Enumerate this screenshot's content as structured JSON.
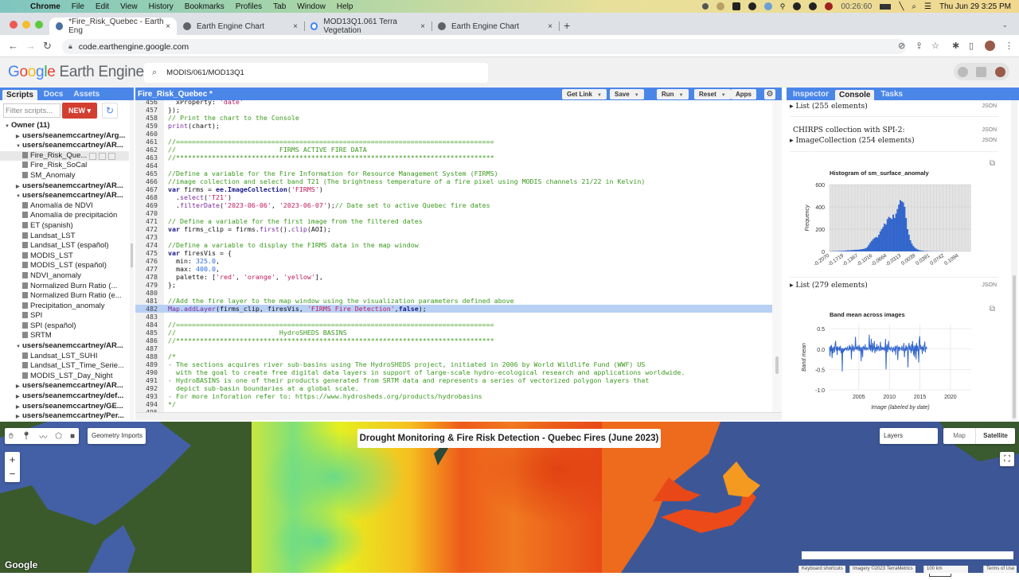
{
  "menubar": {
    "app": "Chrome",
    "items": [
      "File",
      "Edit",
      "View",
      "History",
      "Bookmarks",
      "Profiles",
      "Tab",
      "Window",
      "Help"
    ],
    "timer": "00:26:60",
    "datetime": "Thu Jun 29  3:25 PM"
  },
  "browser": {
    "tabs": [
      {
        "title": "*Fire_Risk_Quebec - Earth Eng",
        "active": true
      },
      {
        "title": "Earth Engine Chart",
        "active": false
      },
      {
        "title": "MOD13Q1.061 Terra Vegetation",
        "active": false
      },
      {
        "title": "Earth Engine Chart",
        "active": false
      }
    ],
    "close": "×",
    "new_tab": "+",
    "url": "code.earthengine.google.com"
  },
  "header": {
    "logo_parts": [
      "G",
      "o",
      "o",
      "g",
      "l",
      "e"
    ],
    "logo_suffix": " Earth Engine",
    "search_value": "MODIS/061/MOD13Q1"
  },
  "left_panel": {
    "tabs": [
      "Scripts",
      "Docs",
      "Assets"
    ],
    "active_tab": "Scripts",
    "filter_placeholder": "Filter scripts...",
    "new_label": "NEW ▾",
    "refresh_icon": "↻",
    "tree": [
      {
        "type": "own",
        "label": "Owner (11)",
        "open": true
      },
      {
        "type": "folder",
        "label": "users/seanemccartney/Arg...",
        "open": false
      },
      {
        "type": "folder",
        "label": "users/seanemccartney/AR...",
        "open": true
      },
      {
        "type": "file",
        "label": "Fire_Risk_Que...",
        "selected": true
      },
      {
        "type": "file",
        "label": "Fire_Risk_SoCal"
      },
      {
        "type": "file",
        "label": "SM_Anomaly"
      },
      {
        "type": "folder",
        "label": "users/seanemccartney/AR...",
        "open": false
      },
      {
        "type": "folder",
        "label": "users/seanemccartney/AR...",
        "open": true
      },
      {
        "type": "file",
        "label": "Anomalía de NDVI"
      },
      {
        "type": "file",
        "label": "Anomalía de precipitación"
      },
      {
        "type": "file",
        "label": "ET (spanish)"
      },
      {
        "type": "file",
        "label": "Landsat_LST"
      },
      {
        "type": "file",
        "label": "Landsat_LST (español)"
      },
      {
        "type": "file",
        "label": "MODIS_LST"
      },
      {
        "type": "file",
        "label": "MODIS_LST (español)"
      },
      {
        "type": "file",
        "label": "NDVI_anomaly"
      },
      {
        "type": "file",
        "label": "Normalized Burn Ratio (..."
      },
      {
        "type": "file",
        "label": "Normalized Burn Ratio (e..."
      },
      {
        "type": "file",
        "label": "Precipitation_anomaly"
      },
      {
        "type": "file",
        "label": "SPI"
      },
      {
        "type": "file",
        "label": "SPI (español)"
      },
      {
        "type": "file",
        "label": "SRTM"
      },
      {
        "type": "folder",
        "label": "users/seanemccartney/AR...",
        "open": true
      },
      {
        "type": "file",
        "label": "Landsat_LST_SUHI"
      },
      {
        "type": "file",
        "label": "Landsat_LST_Time_Serie..."
      },
      {
        "type": "file",
        "label": "MODIS_LST_Day_Night"
      },
      {
        "type": "folder",
        "label": "users/seanemccartney/AR...",
        "open": false
      },
      {
        "type": "folder",
        "label": "users/seanemccartney/def...",
        "open": false
      },
      {
        "type": "folder",
        "label": "users/seanemccartney/GE...",
        "open": false
      },
      {
        "type": "folder",
        "label": "users/seanemccartney/Per...",
        "open": false
      }
    ]
  },
  "editor": {
    "title": "Fire_Risk_Quebec *",
    "buttons": [
      "Get Link",
      "Save",
      "Run",
      "Reset",
      "Apps"
    ],
    "highlighted_line": 482,
    "lines": [
      {
        "n": "456",
        "t": [
          [
            "p",
            "  xProperty: "
          ],
          [
            "s",
            "'date'"
          ]
        ]
      },
      {
        "n": "457",
        "t": [
          [
            "p",
            "});"
          ]
        ]
      },
      {
        "n": "458",
        "t": [
          [
            "c",
            "// Print the chart to the Console"
          ]
        ]
      },
      {
        "n": "459",
        "t": [
          [
            "f",
            "print"
          ],
          [
            "p",
            "(chart);"
          ]
        ]
      },
      {
        "n": "460",
        "t": []
      },
      {
        "n": "461",
        "t": [
          [
            "c",
            "//================================================================================"
          ]
        ]
      },
      {
        "n": "462",
        "t": [
          [
            "c",
            "//                          FIRMS ACTIVE FIRE DATA"
          ]
        ]
      },
      {
        "n": "463",
        "t": [
          [
            "c",
            "//********************************************************************************"
          ]
        ]
      },
      {
        "n": "464",
        "t": []
      },
      {
        "n": "465",
        "t": [
          [
            "c",
            "//Define a variable for the Fire Information for Resource Management System (FIRMS)"
          ]
        ]
      },
      {
        "n": "466",
        "t": [
          [
            "c",
            "//image collection and select band T21 (The brightness temperature of a fire pixel using MODIS channels 21/22 in Kelvin)"
          ]
        ]
      },
      {
        "n": "467",
        "t": [
          [
            "k",
            "var"
          ],
          [
            "p",
            " firms = "
          ],
          [
            "k",
            "ee.ImageCollection"
          ],
          [
            "p",
            "("
          ],
          [
            "s",
            "'FIRMS'"
          ],
          [
            "p",
            ")"
          ]
        ]
      },
      {
        "n": "468",
        "t": [
          [
            "p",
            "  ."
          ],
          [
            "f",
            "select"
          ],
          [
            "p",
            "("
          ],
          [
            "s",
            "'T21'"
          ],
          [
            "p",
            ")"
          ]
        ]
      },
      {
        "n": "469",
        "t": [
          [
            "p",
            "  ."
          ],
          [
            "f",
            "filterDate"
          ],
          [
            "p",
            "("
          ],
          [
            "s",
            "'2023-06-06'"
          ],
          [
            "p",
            ", "
          ],
          [
            "s",
            "'2023-06-07'"
          ],
          [
            "p",
            ");"
          ],
          [
            "c",
            "// Date set to active Quebec fire dates"
          ]
        ]
      },
      {
        "n": "470",
        "t": []
      },
      {
        "n": "471",
        "t": [
          [
            "c",
            "// Define a variable for the first image from the filtered dates"
          ]
        ]
      },
      {
        "n": "472",
        "t": [
          [
            "k",
            "var"
          ],
          [
            "p",
            " firms_clip = firms."
          ],
          [
            "f",
            "first"
          ],
          [
            "p",
            "()."
          ],
          [
            "f",
            "clip"
          ],
          [
            "p",
            "(AOI);"
          ]
        ]
      },
      {
        "n": "473",
        "t": []
      },
      {
        "n": "474",
        "t": [
          [
            "c",
            "//Define a variable to display the FIRMS data in the map window"
          ]
        ]
      },
      {
        "n": "475",
        "t": [
          [
            "k",
            "var"
          ],
          [
            "p",
            " firesVis = {"
          ]
        ]
      },
      {
        "n": "476",
        "t": [
          [
            "p",
            "  min: "
          ],
          [
            "num",
            "325.0"
          ],
          [
            "p",
            ","
          ]
        ]
      },
      {
        "n": "477",
        "t": [
          [
            "p",
            "  max: "
          ],
          [
            "num",
            "400.0"
          ],
          [
            "p",
            ","
          ]
        ]
      },
      {
        "n": "478",
        "t": [
          [
            "p",
            "  palette: ["
          ],
          [
            "s",
            "'red'"
          ],
          [
            "p",
            ", "
          ],
          [
            "s",
            "'orange'"
          ],
          [
            "p",
            ", "
          ],
          [
            "s",
            "'yellow'"
          ],
          [
            "p",
            "],"
          ]
        ]
      },
      {
        "n": "479",
        "t": [
          [
            "p",
            "};"
          ]
        ]
      },
      {
        "n": "480",
        "t": []
      },
      {
        "n": "481",
        "t": [
          [
            "c",
            "//Add the fire layer to the map window using the visualization parameters defined above"
          ]
        ]
      },
      {
        "n": "482",
        "t": [
          [
            "f",
            "Map.addLayer"
          ],
          [
            "p",
            "(firms_clip, firesVis, "
          ],
          [
            "s",
            "'FIRMS Fire Detection'"
          ],
          [
            "p",
            ","
          ],
          [
            "k",
            "false"
          ],
          [
            "p",
            ");"
          ]
        ]
      },
      {
        "n": "483",
        "t": []
      },
      {
        "n": "484",
        "t": [
          [
            "c",
            "//================================================================================"
          ]
        ]
      },
      {
        "n": "485",
        "t": [
          [
            "c",
            "//                          HydroSHEDS BASINS"
          ]
        ]
      },
      {
        "n": "486",
        "t": [
          [
            "c",
            "//********************************************************************************"
          ]
        ]
      },
      {
        "n": "487",
        "t": []
      },
      {
        "n": "488",
        "t": [
          [
            "c",
            "/*"
          ]
        ]
      },
      {
        "n": "489",
        "t": [
          [
            "c",
            "- The sections acquires river sub-basins using The HydroSHEDS project, initiated in 2006 by World Wildlife Fund (WWF) US"
          ]
        ]
      },
      {
        "n": "490",
        "t": [
          [
            "c",
            "  with the goal to create free digital data layers in support of large-scale hydro-ecological research and applications worldwide."
          ]
        ]
      },
      {
        "n": "491",
        "t": [
          [
            "c",
            "- HydroBASINS is one of their products generated from SRTM data and represents a series of vectorized polygon layers that"
          ]
        ]
      },
      {
        "n": "492",
        "t": [
          [
            "c",
            "  depict sub-basin boundaries at a global scale."
          ]
        ]
      },
      {
        "n": "493",
        "t": [
          [
            "c",
            "- For more inforation refer to: https://www.hydrosheds.org/products/hydrobasins"
          ]
        ]
      },
      {
        "n": "494",
        "t": [
          [
            "c",
            "*/"
          ]
        ]
      },
      {
        "n": "495",
        "t": []
      }
    ]
  },
  "right_panel": {
    "tabs": [
      "Inspector",
      "Console",
      "Tasks"
    ],
    "active_tab": "Console",
    "json_label": "JSON",
    "entries": {
      "list1": "▸ List (255 elements)",
      "chirps_title": "CHIRPS collection with SPI-2:",
      "chirps_coll": "▸ ImageCollection (254 elements)",
      "list2": "▸ List (279 elements)"
    }
  },
  "chart_data": [
    {
      "type": "bar",
      "title": "Histogram of sm_surface_anomaly",
      "xlabel": "",
      "ylabel": "Frequency",
      "ylim": [
        0,
        600
      ],
      "yticks": [
        "600",
        "400",
        "200",
        "0"
      ],
      "xticks": [
        "-0.2070",
        "-0.1719",
        "-0.1367",
        "-0.1016",
        "-0.0664",
        "-0.0313",
        "0.0039",
        "0.0391",
        "0.0742",
        "0.1094"
      ],
      "xrange": [
        -0.207,
        0.14
      ],
      "bins_start": -0.207,
      "bin_width": 0.0035,
      "values": [
        2,
        2,
        3,
        3,
        3,
        4,
        4,
        5,
        5,
        6,
        6,
        8,
        9,
        10,
        10,
        12,
        12,
        14,
        15,
        15,
        16,
        18,
        20,
        22,
        25,
        30,
        40,
        60,
        80,
        95,
        110,
        120,
        130,
        125,
        150,
        180,
        200,
        220,
        250,
        240,
        290,
        310,
        300,
        290,
        330,
        300,
        340,
        380,
        420,
        460,
        450,
        440,
        400,
        300,
        200,
        150,
        100,
        70,
        50,
        35,
        25,
        18,
        12,
        9,
        7,
        5,
        4,
        3,
        3,
        2,
        2,
        2,
        1,
        1,
        1,
        1,
        1,
        1,
        1,
        1,
        0,
        0,
        0,
        0,
        0,
        0,
        0,
        0,
        0,
        0,
        0,
        0,
        0,
        0,
        0,
        0,
        0,
        0,
        0,
        0
      ]
    },
    {
      "type": "line",
      "title": "Band mean across images",
      "xlabel": "Image (labeled by date)",
      "ylabel": "Band mean",
      "ylim": [
        -1.0,
        0.6
      ],
      "yticks": [
        "0.5",
        "0.0",
        "-0.5",
        "-1.0"
      ],
      "xticks": [
        "2005",
        "2010",
        "2015",
        "2020"
      ],
      "xrange": [
        2000.2,
        2023.4
      ],
      "series": [
        {
          "name": "Band mean",
          "color": "#3366cc",
          "x_start": 2000.2,
          "x_step": 0.0834,
          "values": [
            0.05,
            -0.18,
            0.08,
            -0.05,
            0.1,
            -0.22,
            0.04,
            -0.1,
            0.02,
            0.06,
            -0.08,
            0.12,
            0.2,
            -0.03,
            0.05,
            -0.15,
            0.07,
            -0.02,
            0.0,
            0.05,
            -0.05,
            0.08,
            -0.02,
            -0.1,
            0.03,
            -0.55,
            0.02,
            -0.08,
            0.01,
            -0.05,
            0.03,
            -0.02,
            0.04,
            0.0,
            -0.03,
            0.05,
            0.02,
            -0.04,
            0.01,
            0.1,
            -0.02,
            0.05,
            0.02,
            -0.25,
            0.12,
            -0.05,
            0.03,
            0.08,
            -0.06,
            0.02,
            0.01,
            0.3,
            -0.02,
            0.05,
            0.0,
            0.08,
            -0.04,
            0.02,
            0.1,
            -0.05,
            0.04,
            0.02,
            -0.3,
            0.05,
            0.01,
            -0.2,
            0.08,
            0.02,
            0.04,
            -0.03,
            0.12,
            0.0,
            -0.02,
            0.03,
            0.0,
            0.02,
            -0.01,
            0.05,
            0.35,
            -0.02,
            0.1,
            -0.05,
            0.25,
            0.02,
            -0.08,
            0.15,
            -0.03,
            0.05,
            0.2,
            -0.1,
            0.02,
            0.05,
            -0.06,
            0.12,
            0.01,
            -0.02,
            0.08,
            0.03,
            -0.05,
            0.02,
            0.18,
            -0.04,
            0.0,
            0.06,
            -0.02,
            0.04,
            0.0,
            0.03,
            -0.05,
            0.02,
            0.25,
            -0.5,
            0.05,
            0.12,
            -0.08,
            0.03,
            0.2,
            -0.02,
            0.04,
            0.0,
            -0.03,
            0.06,
            0.02,
            0.0,
            -0.08,
            0.05,
            0.02,
            -0.04,
            0.0,
            0.08,
            -0.15,
            0.06,
            0.02,
            0.1,
            -0.27,
            0.03,
            0.06,
            -0.05,
            0.04,
            0.02,
            0.0,
            -0.02,
            0.08,
            0.0,
            -0.05,
            0.04,
            0.15,
            -0.2,
            0.02,
            -0.05,
            0.1,
            -0.03,
            0.06,
            0.02,
            -0.45,
            0.05,
            0.15,
            -0.02,
            0.08,
            0.0,
            -0.1,
            0.12,
            -0.05,
            0.2,
            0.02,
            -0.15,
            0.08,
            -0.2,
            0.05,
            0.1,
            -0.25,
            0.15,
            -0.05,
            0.08,
            0.0,
            -0.33,
            0.2,
            0.32,
            -0.02,
            0.1,
            0.0,
            0.05,
            -0.12,
            0.08,
            0.02,
            -0.05,
            0.1,
            0.18,
            -0.08,
            0.03,
            0.05,
            0.0
          ]
        }
      ]
    }
  ],
  "map": {
    "title": "Drought Monitoring & Fire Risk Detection - Quebec Fires (June 2023)",
    "geometry_imports": "Geometry Imports",
    "zoom_in": "+",
    "zoom_out": "−",
    "layers": "Layers",
    "map_type_map": "Map",
    "map_type_satellite": "Satellite",
    "fullscreen_icon": "⛶",
    "google_logo": "Google",
    "attribution": [
      "Keyboard shortcuts",
      "Imagery ©2023 TerraMetrics",
      "100 km",
      "Terms of Use"
    ]
  }
}
